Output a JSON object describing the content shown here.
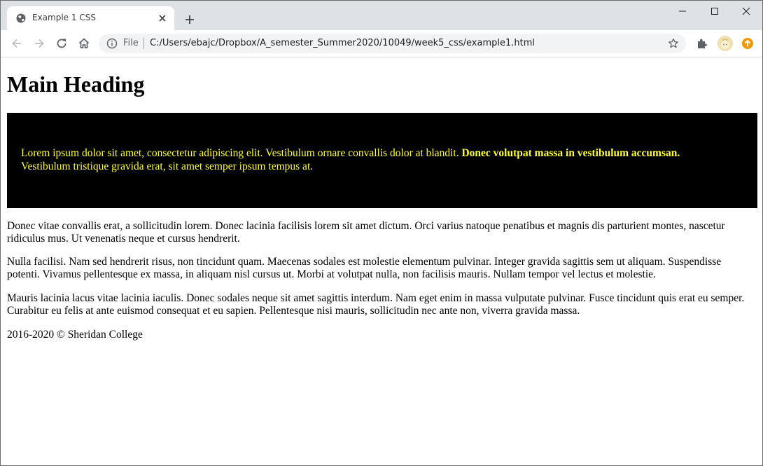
{
  "browser": {
    "tab": {
      "title": "Example 1 CSS",
      "favicon": "globe-icon"
    },
    "new_tab_icon": "plus-icon",
    "window_controls": [
      "minimize-icon",
      "maximize-icon",
      "close-icon"
    ],
    "toolbar": {
      "back_icon": "arrow-left-icon",
      "forward_icon": "arrow-right-icon",
      "reload_icon": "reload-icon",
      "home_icon": "home-icon"
    },
    "omnibox": {
      "scheme_label": "File",
      "url": "C:/Users/ebajc/Dropbox/A_semester_Summer2020/10049/week5_css/example1.html",
      "info_icon": "info-icon",
      "bookmark_icon": "star-icon"
    },
    "extensions_icon": "puzzle-icon",
    "profile_icon": "avatar",
    "update_icon": "update-icon"
  },
  "page": {
    "heading": "Main Heading",
    "highlight": {
      "text_regular": "Lorem ipsum dolor sit amet, consectetur adipiscing elit. Vestibulum ornare convallis dolor at blandit.",
      "text_bold": "Donec volutpat massa in vestibulum accumsan.",
      "text_tail": "Vestibulum tristique gravida erat, sit amet semper ipsum tempus at.",
      "background_color": "#000000",
      "text_color": "#ffff33"
    },
    "paragraphs": [
      "Donec vitae convallis erat, a sollicitudin lorem. Donec lacinia facilisis lorem sit amet dictum. Orci varius natoque penatibus et magnis dis parturient montes, nascetur ridiculus mus. Ut venenatis neque et cursus hendrerit.",
      "Nulla facilisi. Nam sed hendrerit risus, non tincidunt quam. Maecenas sodales est molestie elementum pulvinar. Integer gravida sagittis sem ut aliquam. Suspendisse potenti. Vivamus pellentesque ex massa, in aliquam nisl cursus ut. Morbi at volutpat nulla, non facilisis mauris. Nullam tempor vel lectus et molestie.",
      "Mauris lacinia lacus vitae lacinia iaculis. Donec sodales neque sit amet sagittis interdum. Nam eget enim in massa vulputate pulvinar. Fusce tincidunt quis erat eu semper. Curabitur eu felis at ante euismod consequat et eu sapien. Pellentesque nisi mauris, sollicitudin nec ante non, viverra gravida massa."
    ],
    "footer": "2016-2020 © Sheridan College"
  }
}
